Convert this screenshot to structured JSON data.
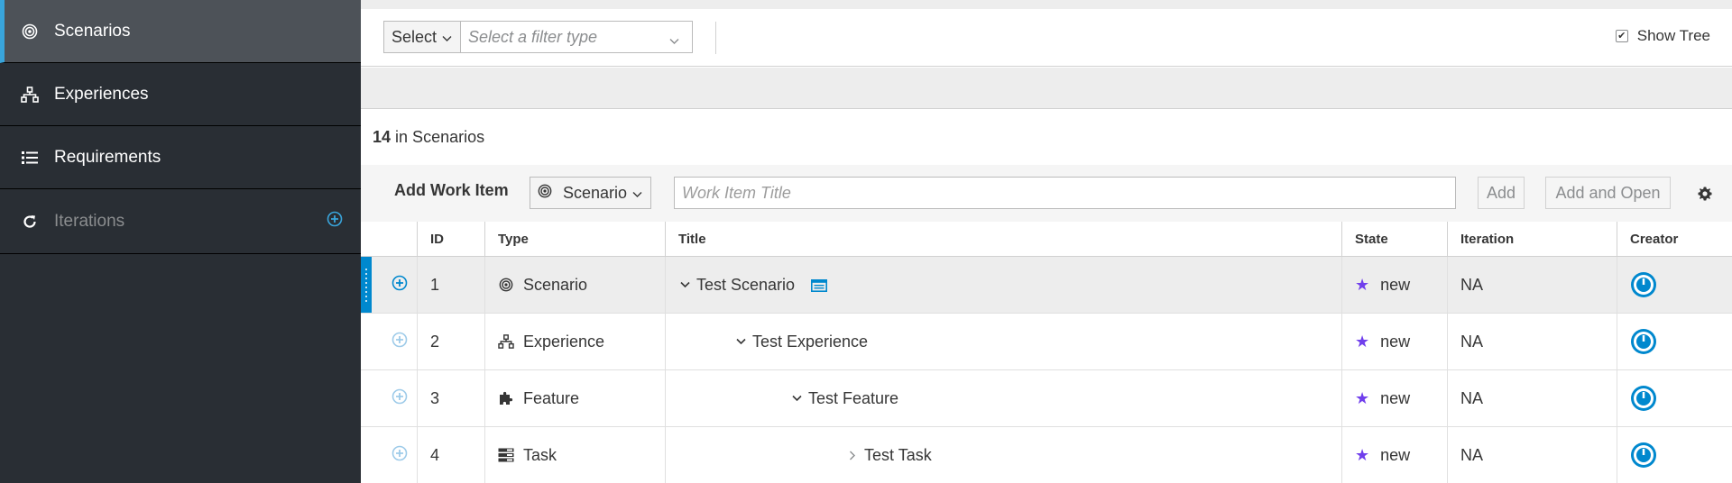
{
  "sidebar": {
    "items": [
      {
        "label": "Scenarios",
        "icon": "scenario-icon",
        "active": true
      },
      {
        "label": "Experiences",
        "icon": "experience-icon",
        "active": false
      },
      {
        "label": "Requirements",
        "icon": "list-icon",
        "active": false
      },
      {
        "label": "Iterations",
        "icon": "refresh-icon",
        "active": false,
        "disabled": true
      }
    ]
  },
  "toolbar": {
    "select_label": "Select",
    "filter_placeholder": "Select a filter type",
    "show_tree_label": "Show Tree",
    "show_tree_checked": true
  },
  "summary": {
    "count": "14",
    "suffix": "in Scenarios"
  },
  "add_bar": {
    "label": "Add Work Item",
    "type_label": "Scenario",
    "title_placeholder": "Work Item Title",
    "add_label": "Add",
    "add_open_label": "Add and Open"
  },
  "table": {
    "headers": {
      "id": "ID",
      "type": "Type",
      "title": "Title",
      "state": "State",
      "iteration": "Iteration",
      "creator": "Creator"
    },
    "rows": [
      {
        "id": "1",
        "type": "Scenario",
        "type_icon": "scenario-icon",
        "title": "Test Scenario",
        "state": "new",
        "iteration": "NA",
        "expanded": true,
        "level": 0
      },
      {
        "id": "2",
        "type": "Experience",
        "type_icon": "experience-icon",
        "title": "Test Experience",
        "state": "new",
        "iteration": "NA",
        "expanded": true,
        "level": 1
      },
      {
        "id": "3",
        "type": "Feature",
        "type_icon": "puzzle-icon",
        "title": "Test Feature",
        "state": "new",
        "iteration": "NA",
        "expanded": true,
        "level": 2
      },
      {
        "id": "4",
        "type": "Task",
        "type_icon": "task-icon",
        "title": "Test Task",
        "state": "new",
        "iteration": "NA",
        "expanded": false,
        "level": 3
      }
    ]
  },
  "colors": {
    "sidebar_bg": "#292e34",
    "sidebar_active": "#4d5258",
    "accent": "#0088ce",
    "state_star": "#703fec"
  }
}
